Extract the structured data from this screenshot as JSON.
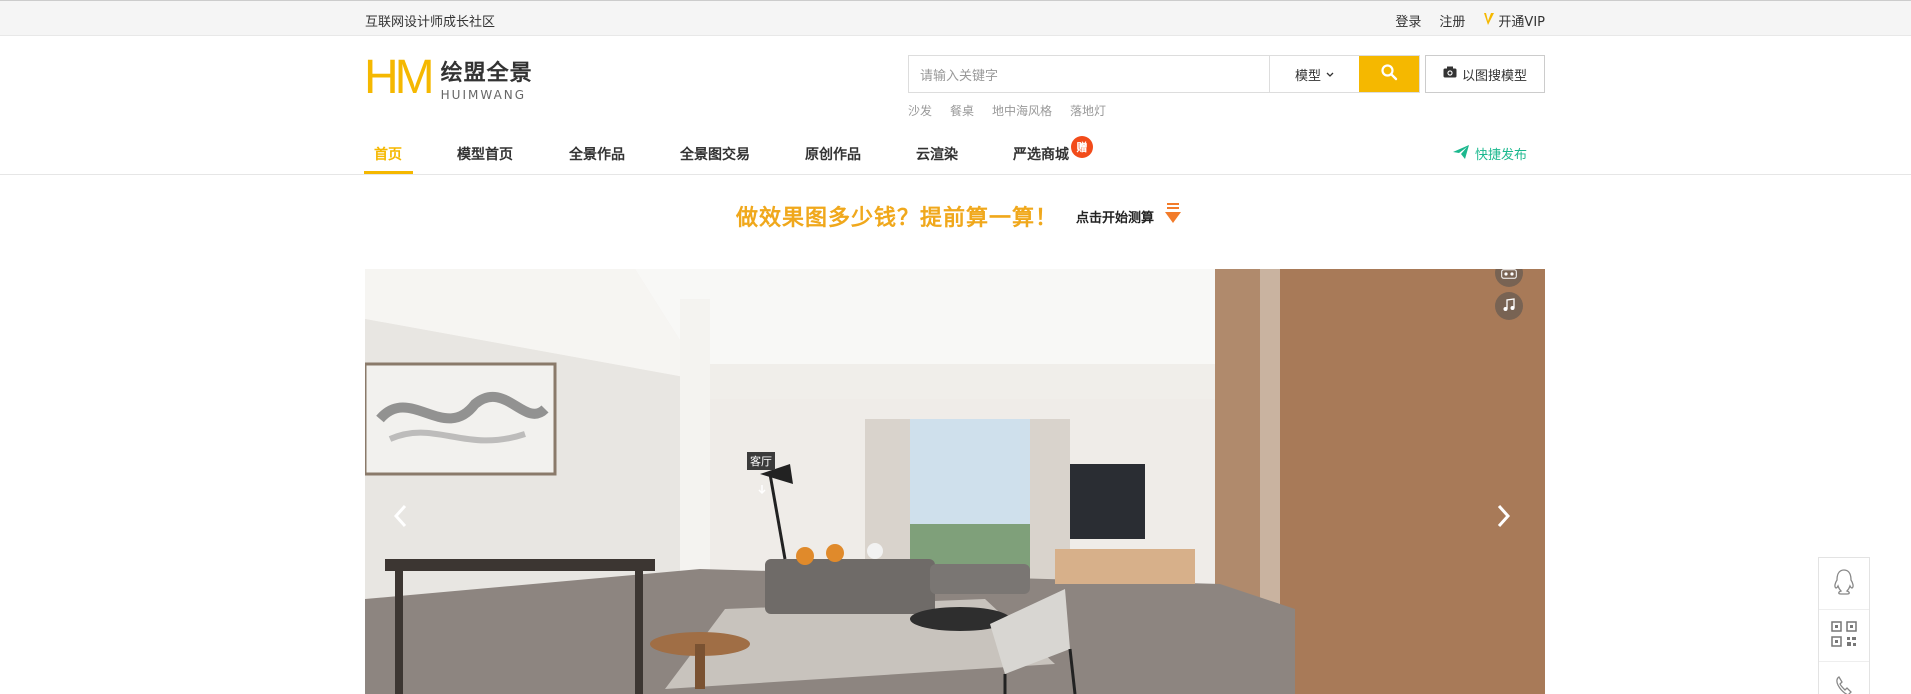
{
  "topbar": {
    "slogan": "互联网设计师成长社区",
    "login": "登录",
    "register": "注册",
    "vip": "开通VIP"
  },
  "logo": {
    "mark": "HM",
    "cn": "绘盟全景",
    "en": "HUIMWANG"
  },
  "search": {
    "placeholder": "请输入关键字",
    "category": "模型",
    "image_search": "以图搜模型",
    "hot_words": [
      "沙发",
      "餐桌",
      "地中海风格",
      "落地灯"
    ]
  },
  "nav": {
    "items": [
      "首页",
      "模型首页",
      "全景作品",
      "全景图交易",
      "原创作品",
      "云渲染",
      "严选商城"
    ],
    "badge": "赠",
    "quick_publish": "快捷发布"
  },
  "promo": {
    "headline": "做效果图多少钱？提前算一算！",
    "cta": "点击开始测算"
  },
  "banner": {
    "hotspot_label": "客厅"
  },
  "colors": {
    "accent": "#f5b800",
    "promo": "#f0a81c",
    "green": "#1bb88e",
    "badge": "#f24b1a"
  },
  "icons": [
    "search-icon",
    "camera-icon",
    "paper-plane-icon",
    "vr-icon",
    "music-icon",
    "chevron-left-icon",
    "chevron-right-icon",
    "qq-icon",
    "qr-code-icon",
    "phone-icon"
  ]
}
